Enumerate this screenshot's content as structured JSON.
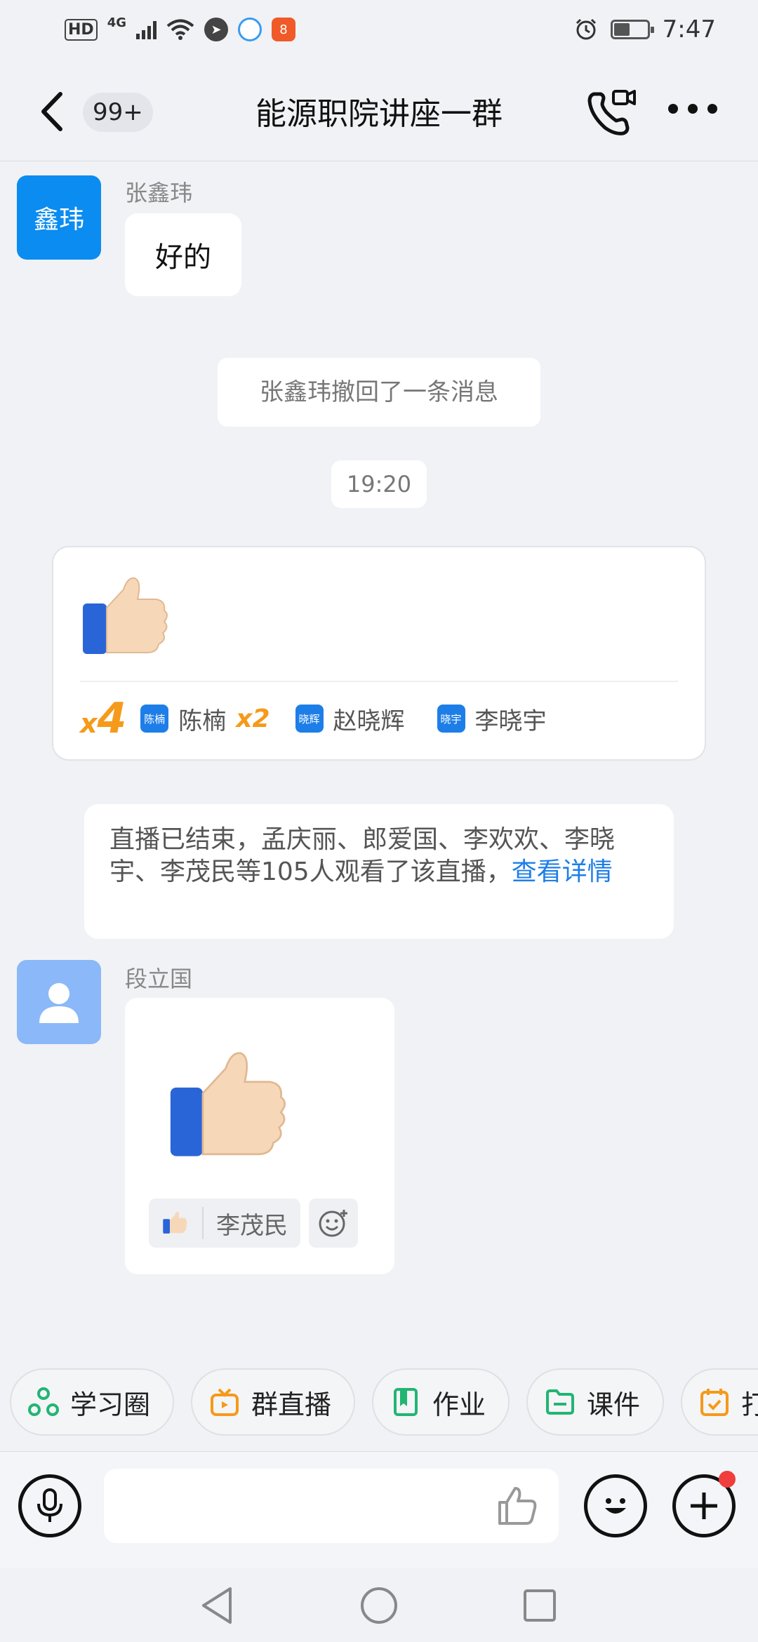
{
  "status_bar": {
    "left_tags": [
      "HD",
      "4G"
    ],
    "time": "7:47",
    "app_badge_text": "8"
  },
  "header": {
    "unread_badge": "99+",
    "title": "能源职院讲座一群"
  },
  "messages": {
    "m1": {
      "avatar_text": "鑫玮",
      "sender": "张鑫玮",
      "text": "好的"
    },
    "recall_notice": "张鑫玮撤回了一条消息",
    "timestamp": "19:20",
    "like_card": {
      "total_prefix": "x",
      "total_count": "4",
      "reactors": [
        {
          "avatar_text": "陈楠",
          "name": "陈楠",
          "multiplier": "x2"
        },
        {
          "avatar_text": "晓辉",
          "name": "赵晓辉"
        },
        {
          "avatar_text": "晓宇",
          "name": "李晓宇"
        }
      ]
    },
    "live_notice": {
      "text": "直播已结束，孟庆丽、郎爱国、李欢欢、李晓宇、李茂民等105人观看了该直播，",
      "link": "查看详情"
    },
    "m2": {
      "sender": "段立国",
      "reaction_user": "李茂民"
    }
  },
  "chips": [
    {
      "label": "学习圈",
      "icon": "circle-network-icon",
      "color": "#22b573"
    },
    {
      "label": "群直播",
      "icon": "tv-icon",
      "color": "#f59a1a"
    },
    {
      "label": "作业",
      "icon": "book-icon",
      "color": "#22b573"
    },
    {
      "label": "课件",
      "icon": "folder-icon",
      "color": "#22b573"
    },
    {
      "label": "打卡",
      "icon": "calendar-check-icon",
      "color": "#f59a1a"
    }
  ],
  "colors": {
    "accent_blue": "#1e7ee8",
    "avatar_blue": "#0b8cf0",
    "avatar_default": "#8bb8f8",
    "orange": "#f59a1a",
    "green": "#22b573",
    "red_dot": "#f03d3d"
  }
}
